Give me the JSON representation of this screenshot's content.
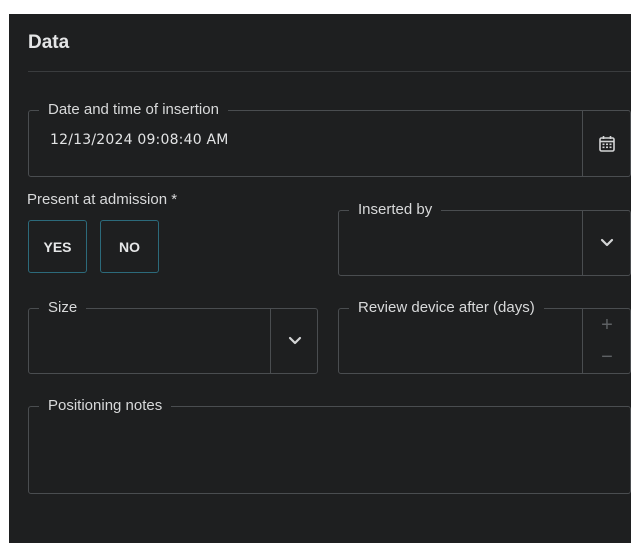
{
  "section": {
    "title": "Data"
  },
  "insertion": {
    "label": "Date and time of insertion",
    "value": "12/13/2024 09:08:40 AM",
    "icon": "calendar-icon"
  },
  "admission": {
    "label": "Present at admission *",
    "yes_label": "YES",
    "no_label": "NO"
  },
  "inserted_by": {
    "label": "Inserted by",
    "value": "",
    "icon": "chevron-down-icon"
  },
  "size": {
    "label": "Size",
    "value": "",
    "icon": "chevron-down-icon"
  },
  "review": {
    "label": "Review device after (days)",
    "value": "",
    "plus": "+",
    "minus": "−"
  },
  "notes": {
    "label": "Positioning notes",
    "value": ""
  },
  "colors": {
    "panel_bg": "#1e1f20",
    "border": "#4a4d50",
    "toggle_border": "#2c6a7b",
    "text": "#d8d9da"
  }
}
